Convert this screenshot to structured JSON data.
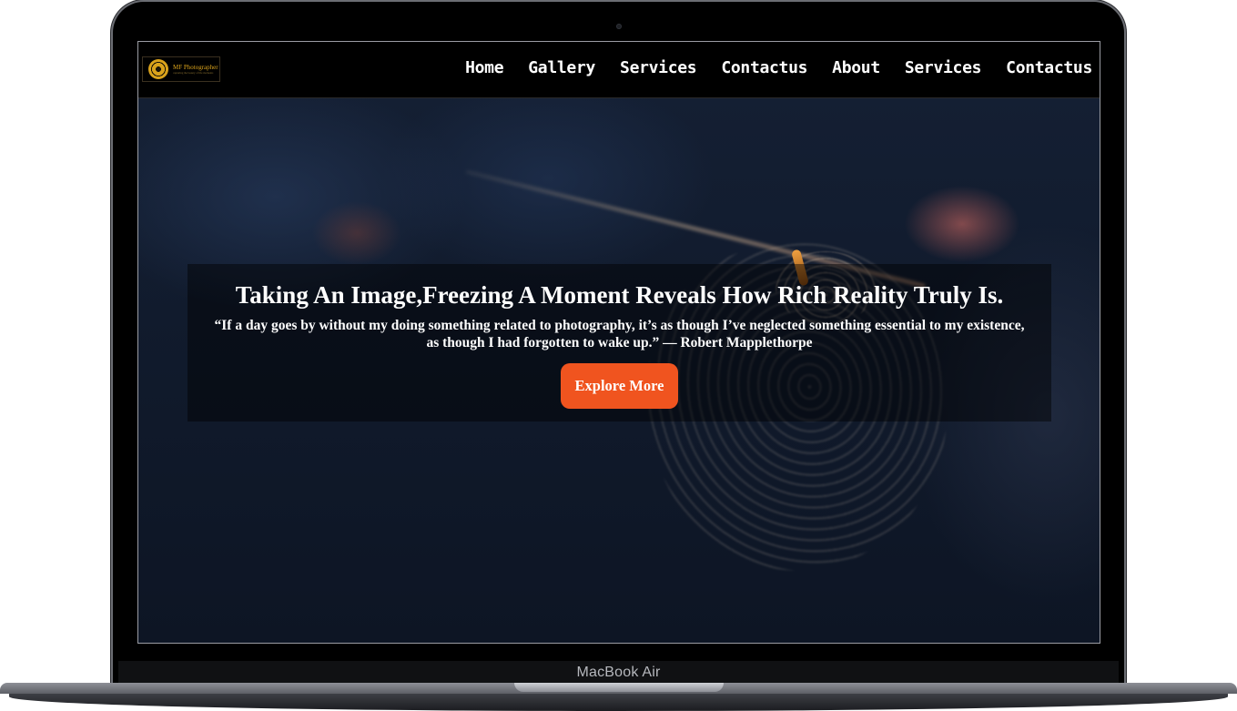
{
  "device": {
    "brand_label": "MacBook Air"
  },
  "navbar": {
    "logo": {
      "name": "MF Photographer",
      "tagline": "capturing the beauty of life moments"
    },
    "links": [
      {
        "label": "Home"
      },
      {
        "label": "Gallery"
      },
      {
        "label": "Services"
      },
      {
        "label": "Contactus"
      },
      {
        "label": "About"
      },
      {
        "label": "Services"
      },
      {
        "label": "Contactus"
      }
    ]
  },
  "hero": {
    "title": "Taking An Image,Freezing A Moment Reveals How Rich Reality Truly Is.",
    "quote": "“If a day goes by without my doing something related to photography, it’s as though I’ve neglected something essential to my existence, as though I had forgotten to wake up.” — Robert Mapplethorpe",
    "button_label": "Explore More"
  },
  "colors": {
    "accent": "#f0541f",
    "nav_background": "#000000",
    "logo_gold": "#d9a21b"
  },
  "icons": {
    "logo": "camera-aperture-icon"
  }
}
